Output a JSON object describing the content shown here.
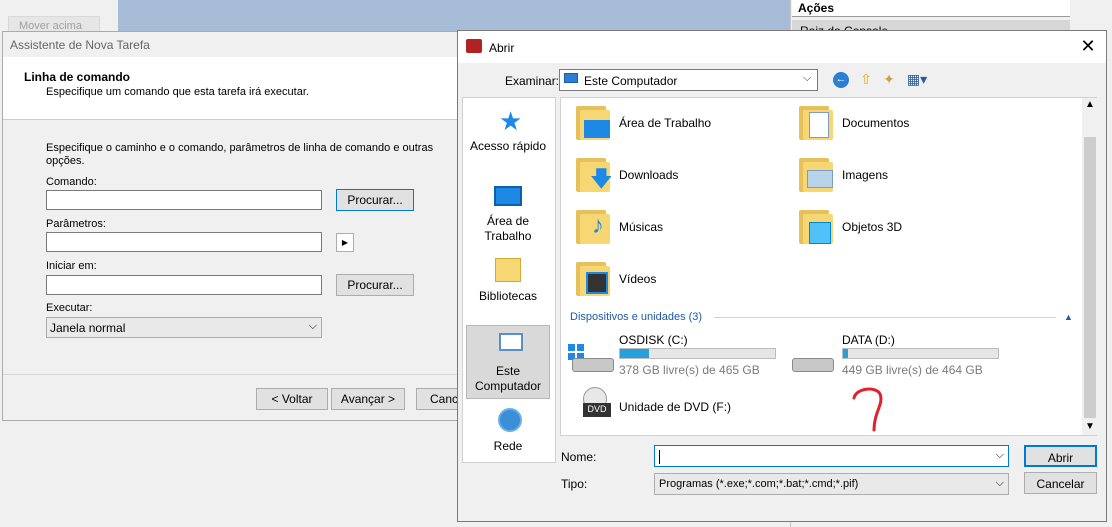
{
  "background": {
    "move_up": "Mover acima",
    "actions_header": "Ações",
    "actions_root": "Raiz do Console"
  },
  "wizard": {
    "title": "Assistente de Nova Tarefa",
    "heading": "Linha de comando",
    "subheading": "Especifique um comando que esta tarefa irá executar.",
    "instructions": "Especifique o caminho e o comando, parâmetros de linha de comando e outras opções.",
    "command_label": "Comando:",
    "command_value": "",
    "browse1": "Procurar...",
    "params_label": "Parâmetros:",
    "params_value": "",
    "start_label": "Iniciar em:",
    "start_value": "",
    "browse2": "Procurar...",
    "run_label": "Executar:",
    "run_value": "Janela normal",
    "back": "< Voltar",
    "next": "Avançar >",
    "cancel": "Cancelar"
  },
  "open_dialog": {
    "title": "Abrir",
    "lookin_label": "Examinar:",
    "lookin_value": "Este Computador",
    "places": [
      {
        "label": "Acesso rápido"
      },
      {
        "label": "Área de Trabalho"
      },
      {
        "label": "Bibliotecas"
      },
      {
        "label": "Este Computador"
      },
      {
        "label": "Rede"
      }
    ],
    "folders": [
      {
        "label": "Área de Trabalho"
      },
      {
        "label": "Documentos"
      },
      {
        "label": "Downloads"
      },
      {
        "label": "Imagens"
      },
      {
        "label": "Músicas"
      },
      {
        "label": "Objetos 3D"
      },
      {
        "label": "Vídeos"
      }
    ],
    "devices_header": "Dispositivos e unidades (3)",
    "drives": [
      {
        "name": "OSDISK (C:)",
        "free": "378 GB livre(s) de 465 GB",
        "used_fraction": 0.19
      },
      {
        "name": "DATA (D:)",
        "free": "449 GB livre(s) de 464 GB",
        "used_fraction": 0.03
      },
      {
        "name": "Unidade de DVD (F:)"
      }
    ],
    "dvd_badge": "DVD",
    "name_label": "Nome:",
    "name_value": "",
    "type_label": "Tipo:",
    "type_value": "Programas (*.exe;*.com;*.bat;*.cmd;*.pif)",
    "open_button": "Abrir",
    "cancel_button": "Cancelar"
  },
  "colors": {
    "accent": "#0078d7",
    "drive_fill": "#26a0da",
    "folder": "#f7d774",
    "annotation": "#e0202a"
  }
}
